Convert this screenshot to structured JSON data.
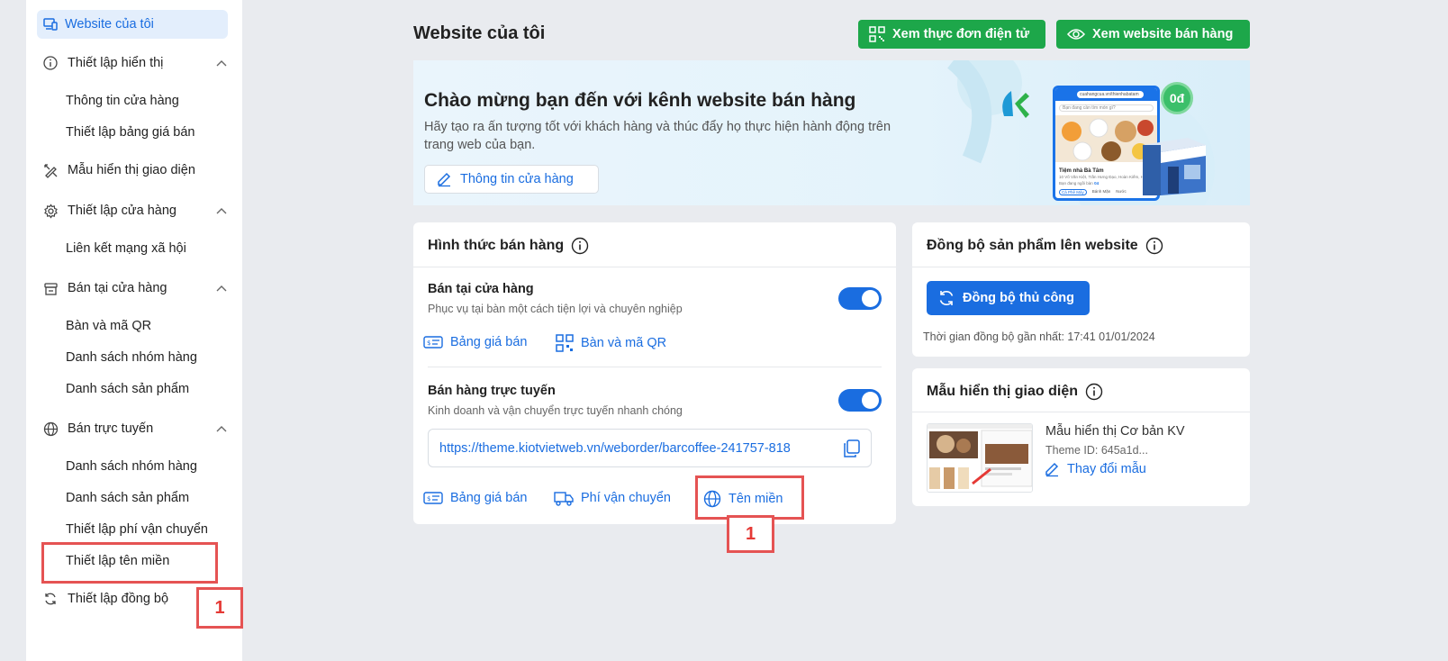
{
  "sidebar": {
    "active": "Website của tôi",
    "groups": [
      {
        "label": "Thiết lập hiển thị",
        "items": [
          "Thông tin cửa hàng",
          "Thiết lập bảng giá bán"
        ]
      },
      {
        "label": "Mẫu hiển thị giao diện"
      },
      {
        "label": "Thiết lập cửa hàng",
        "items": [
          "Liên kết mạng xã hội"
        ]
      },
      {
        "label": "Bán tại cửa hàng",
        "items": [
          "Bàn và mã QR",
          "Danh sách nhóm hàng",
          "Danh sách sản phẩm"
        ]
      },
      {
        "label": "Bán trực tuyến",
        "items": [
          "Danh sách nhóm hàng",
          "Danh sách sản phẩm",
          "Thiết lập phí vận chuyển",
          "Thiết lập tên miền"
        ]
      },
      {
        "label": "Thiết lập đồng bộ"
      }
    ]
  },
  "header": {
    "title": "Website của tôi",
    "btn_menu": "Xem thực đơn điện tử",
    "btn_website": "Xem website bán hàng"
  },
  "banner": {
    "title": "Chào mừng bạn đến với kênh website bán hàng",
    "desc": "Hãy tạo ra ấn tượng tốt với khách hàng và thúc đẩy họ thực hiện hành động trên trang web của bạn.",
    "btn": "Thông tin cửa hàng",
    "mock_url": "cuahangcua.vn/thienhabatam",
    "mock_search": "Bạn đang cần tìm món gì?",
    "mock_store": "Tiệm nhà Bà Tâm",
    "mock_address": "10 Võ Văn Kiệt, Trần Hưng Đạo, Hoàn Kiếm, HN",
    "mock_table_prefix": "Bạn đang ngồi bàn",
    "mock_table": "04",
    "mock_tabs": [
      "Cà Phê Máy",
      "Bánh Mặn",
      "Nước"
    ],
    "coin": "0đ"
  },
  "sales": {
    "title": "Hình thức bán hàng",
    "store": {
      "title": "Bán tại cửa hàng",
      "desc": "Phục vụ tại bàn một cách tiện lợi và chuyên nghiệp",
      "link1": "Bảng giá bán",
      "link2": "Bàn và mã QR"
    },
    "online": {
      "title": "Bán hàng trực tuyến",
      "desc": "Kinh doanh và vận chuyển trực tuyến nhanh chóng",
      "url": "https://theme.kiotvietweb.vn/weborder/barcoffee-241757-818",
      "link1": "Bảng giá bán",
      "link2": "Phí vận chuyển",
      "link3": "Tên miền"
    }
  },
  "sync": {
    "title": "Đồng bộ sản phẩm lên website",
    "btn": "Đồng bộ thủ công",
    "time": "Thời gian đồng bộ gần nhất: 17:41 01/01/2024"
  },
  "theme": {
    "title": "Mẫu hiển thị giao diện",
    "name": "Mẫu hiển thị Cơ bản KV",
    "id": "Theme ID: 645a1d...",
    "change": "Thay đổi mẫu"
  },
  "annotations": {
    "label1": "1",
    "label2": "1"
  }
}
